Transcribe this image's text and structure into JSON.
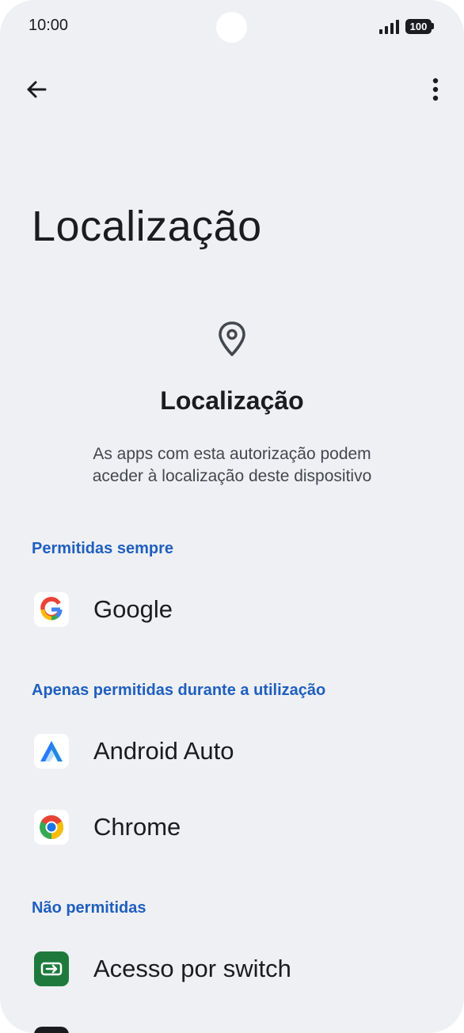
{
  "status_bar": {
    "time": "10:00",
    "battery": "100"
  },
  "toolbar": {
    "back_icon": "arrow-left-icon",
    "more_icon": "more-vert-icon"
  },
  "page": {
    "title": "Localização"
  },
  "header": {
    "icon": "location-pin-icon",
    "title": "Localização",
    "description_line1": "As apps com esta autorização podem",
    "description_line2": "aceder à localização deste dispositivo"
  },
  "sections": {
    "always": {
      "label": "Permitidas sempre",
      "apps": [
        {
          "name": "Google",
          "icon": "google-icon"
        }
      ]
    },
    "while_in_use": {
      "label": "Apenas permitidas durante a utilização",
      "apps": [
        {
          "name": "Android Auto",
          "icon": "android-auto-icon"
        },
        {
          "name": "Chrome",
          "icon": "chrome-icon"
        }
      ]
    },
    "denied": {
      "label": "Não permitidas",
      "apps": [
        {
          "name": "Acesso por switch",
          "icon": "switch-access-icon"
        }
      ]
    }
  },
  "colors": {
    "background": "#eff0f3",
    "accent": "#1f5fbf",
    "text": "#1b1c1f"
  }
}
